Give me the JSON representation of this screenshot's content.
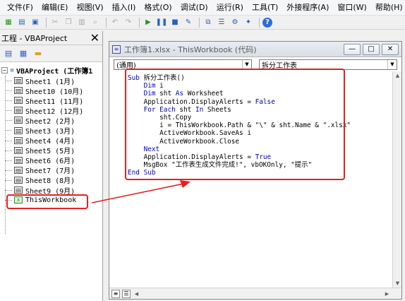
{
  "menubar": {
    "items": [
      "文件(F)",
      "编辑(E)",
      "视图(V)",
      "插入(I)",
      "格式(O)",
      "调试(D)",
      "运行(R)",
      "工具(T)",
      "外接程序(A)",
      "窗口(W)",
      "帮助(H)"
    ]
  },
  "project": {
    "title": "工程 - VBAProject",
    "close": "✕",
    "root": "VBAProject (工作簿1",
    "items": [
      "Sheet1 (1月)",
      "Sheet10 (10月)",
      "Sheet11 (11月)",
      "Sheet12 (12月)",
      "Sheet2 (2月)",
      "Sheet3 (3月)",
      "Sheet4 (4月)",
      "Sheet5 (5月)",
      "Sheet6 (6月)",
      "Sheet7 (7月)",
      "Sheet8 (8月)",
      "Sheet9 (9月)"
    ],
    "workbook": "ThisWorkbook"
  },
  "code_window": {
    "title": "工作簿1.xlsx - ThisWorkbook (代码)",
    "object_dropdown": "(通用)",
    "procedure_dropdown": "拆分工作表",
    "lines": [
      [
        {
          "t": "Sub",
          "k": true
        },
        {
          "t": " 拆分工作表()",
          "k": false
        }
      ],
      [
        {
          "t": "    ",
          "k": false
        },
        {
          "t": "Dim",
          "k": true
        },
        {
          "t": " i",
          "k": false
        }
      ],
      [
        {
          "t": "    ",
          "k": false
        },
        {
          "t": "Dim",
          "k": true
        },
        {
          "t": " sht ",
          "k": false
        },
        {
          "t": "As",
          "k": true
        },
        {
          "t": " Worksheet",
          "k": false
        }
      ],
      [
        {
          "t": "    Application.DisplayAlerts = ",
          "k": false
        },
        {
          "t": "False",
          "k": true
        }
      ],
      [
        {
          "t": "    ",
          "k": false
        },
        {
          "t": "For Each",
          "k": true
        },
        {
          "t": " sht ",
          "k": false
        },
        {
          "t": "In",
          "k": true
        },
        {
          "t": " Sheets",
          "k": false
        }
      ],
      [
        {
          "t": "        sht.Copy",
          "k": false
        }
      ],
      [
        {
          "t": "        i = ThisWorkbook.Path & \"\\\" & sht.Name & \".xlsx\"",
          "k": false
        }
      ],
      [
        {
          "t": "        ActiveWorkbook.SaveAs i",
          "k": false
        }
      ],
      [
        {
          "t": "        ActiveWorkbook.Close",
          "k": false
        }
      ],
      [
        {
          "t": "    ",
          "k": false
        },
        {
          "t": "Next",
          "k": true
        }
      ],
      [
        {
          "t": "    Application.DisplayAlerts = ",
          "k": false
        },
        {
          "t": "True",
          "k": true
        }
      ],
      [
        {
          "t": "    MsgBox \"工作表生成文件完成!\", vbOKOnly, \"提示\"",
          "k": false
        }
      ],
      [
        {
          "t": "End Sub",
          "k": true
        }
      ]
    ]
  },
  "colors": {
    "keyword": "#0000c8",
    "highlight": "#e32020"
  }
}
